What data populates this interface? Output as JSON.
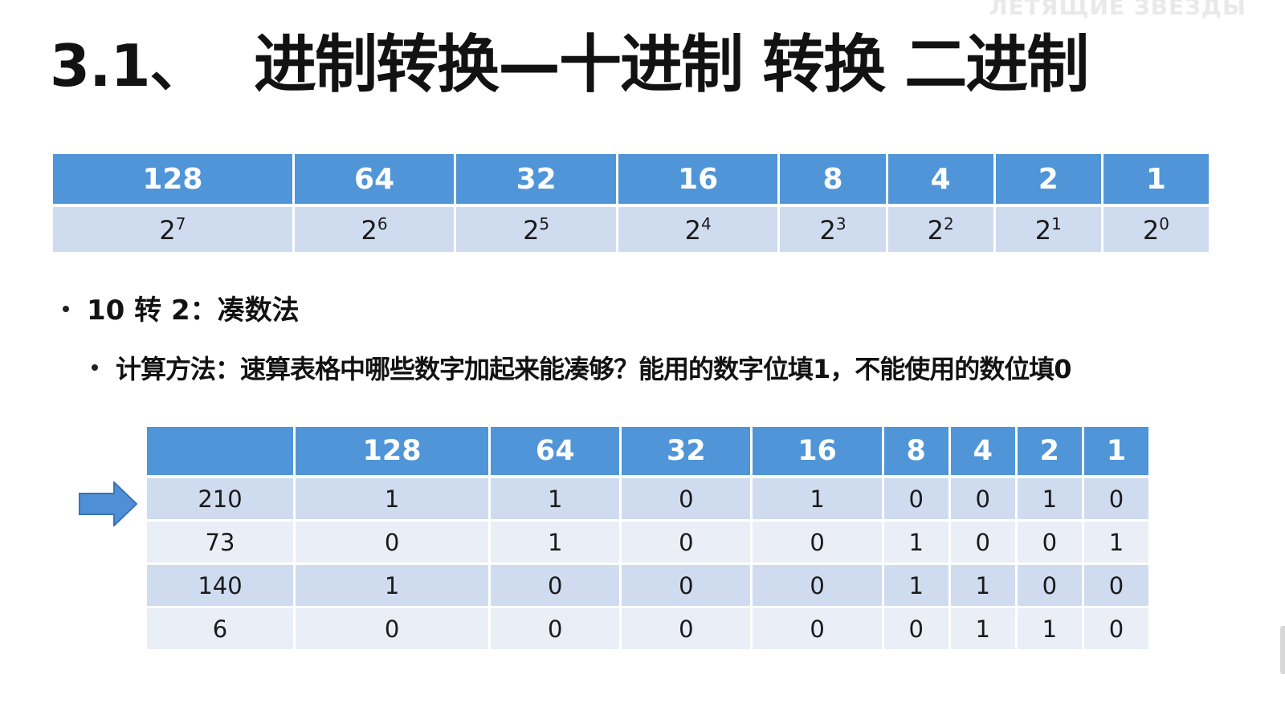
{
  "watermark": "ЛЕТЯЩИЕ ЗВЕЗДЫ",
  "title": {
    "number": "3.1、",
    "text": "进制转换—十进制 转换 二进制"
  },
  "power_table": {
    "headers": [
      "128",
      "64",
      "32",
      "16",
      "8",
      "4",
      "2",
      "1"
    ],
    "base": "2",
    "exponents": [
      "7",
      "6",
      "5",
      "4",
      "3",
      "2",
      "1",
      "0"
    ]
  },
  "bullets": [
    {
      "text": "10 转 2：凑数法"
    },
    {
      "text": "计算方法：速算表格中哪些数字加起来能凑够？能用的数字位填1，不能使用的数位填0"
    }
  ],
  "conversion_table": {
    "headers": [
      "",
      "128",
      "64",
      "32",
      "16",
      "8",
      "4",
      "2",
      "1"
    ],
    "rows": [
      [
        "210",
        "1",
        "1",
        "0",
        "1",
        "0",
        "0",
        "1",
        "0"
      ],
      [
        "73",
        "0",
        "1",
        "0",
        "0",
        "1",
        "0",
        "0",
        "1"
      ],
      [
        "140",
        "1",
        "0",
        "0",
        "0",
        "1",
        "1",
        "0",
        "0"
      ],
      [
        "6",
        "0",
        "0",
        "0",
        "0",
        "0",
        "1",
        "1",
        "0"
      ]
    ]
  },
  "colors": {
    "header_blue": "#4f95d8",
    "row_light": "#cfdcf0",
    "row_lighter": "#e9eef7",
    "arrow_blue": "#4f8fd6"
  },
  "icons": {
    "row_pointer": "right-arrow-icon"
  }
}
